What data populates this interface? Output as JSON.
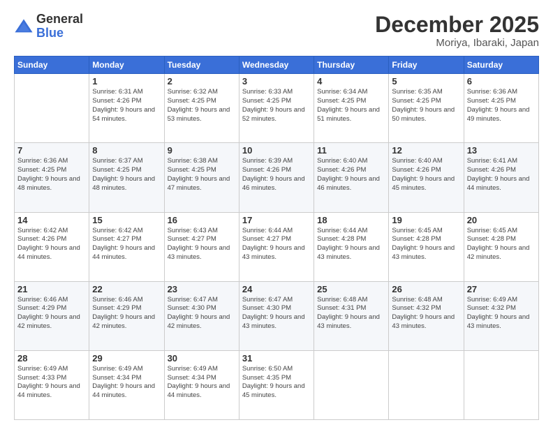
{
  "header": {
    "logo": {
      "line1": "General",
      "line2": "Blue"
    },
    "title": "December 2025",
    "subtitle": "Moriya, Ibaraki, Japan"
  },
  "weekdays": [
    "Sunday",
    "Monday",
    "Tuesday",
    "Wednesday",
    "Thursday",
    "Friday",
    "Saturday"
  ],
  "weeks": [
    [
      {
        "day": "",
        "sunrise": "",
        "sunset": "",
        "daylight": "",
        "empty": true
      },
      {
        "day": "1",
        "sunrise": "Sunrise: 6:31 AM",
        "sunset": "Sunset: 4:26 PM",
        "daylight": "Daylight: 9 hours and 54 minutes."
      },
      {
        "day": "2",
        "sunrise": "Sunrise: 6:32 AM",
        "sunset": "Sunset: 4:25 PM",
        "daylight": "Daylight: 9 hours and 53 minutes."
      },
      {
        "day": "3",
        "sunrise": "Sunrise: 6:33 AM",
        "sunset": "Sunset: 4:25 PM",
        "daylight": "Daylight: 9 hours and 52 minutes."
      },
      {
        "day": "4",
        "sunrise": "Sunrise: 6:34 AM",
        "sunset": "Sunset: 4:25 PM",
        "daylight": "Daylight: 9 hours and 51 minutes."
      },
      {
        "day": "5",
        "sunrise": "Sunrise: 6:35 AM",
        "sunset": "Sunset: 4:25 PM",
        "daylight": "Daylight: 9 hours and 50 minutes."
      },
      {
        "day": "6",
        "sunrise": "Sunrise: 6:36 AM",
        "sunset": "Sunset: 4:25 PM",
        "daylight": "Daylight: 9 hours and 49 minutes."
      }
    ],
    [
      {
        "day": "7",
        "sunrise": "Sunrise: 6:36 AM",
        "sunset": "Sunset: 4:25 PM",
        "daylight": "Daylight: 9 hours and 48 minutes."
      },
      {
        "day": "8",
        "sunrise": "Sunrise: 6:37 AM",
        "sunset": "Sunset: 4:25 PM",
        "daylight": "Daylight: 9 hours and 48 minutes."
      },
      {
        "day": "9",
        "sunrise": "Sunrise: 6:38 AM",
        "sunset": "Sunset: 4:25 PM",
        "daylight": "Daylight: 9 hours and 47 minutes."
      },
      {
        "day": "10",
        "sunrise": "Sunrise: 6:39 AM",
        "sunset": "Sunset: 4:26 PM",
        "daylight": "Daylight: 9 hours and 46 minutes."
      },
      {
        "day": "11",
        "sunrise": "Sunrise: 6:40 AM",
        "sunset": "Sunset: 4:26 PM",
        "daylight": "Daylight: 9 hours and 46 minutes."
      },
      {
        "day": "12",
        "sunrise": "Sunrise: 6:40 AM",
        "sunset": "Sunset: 4:26 PM",
        "daylight": "Daylight: 9 hours and 45 minutes."
      },
      {
        "day": "13",
        "sunrise": "Sunrise: 6:41 AM",
        "sunset": "Sunset: 4:26 PM",
        "daylight": "Daylight: 9 hours and 44 minutes."
      }
    ],
    [
      {
        "day": "14",
        "sunrise": "Sunrise: 6:42 AM",
        "sunset": "Sunset: 4:26 PM",
        "daylight": "Daylight: 9 hours and 44 minutes."
      },
      {
        "day": "15",
        "sunrise": "Sunrise: 6:42 AM",
        "sunset": "Sunset: 4:27 PM",
        "daylight": "Daylight: 9 hours and 44 minutes."
      },
      {
        "day": "16",
        "sunrise": "Sunrise: 6:43 AM",
        "sunset": "Sunset: 4:27 PM",
        "daylight": "Daylight: 9 hours and 43 minutes."
      },
      {
        "day": "17",
        "sunrise": "Sunrise: 6:44 AM",
        "sunset": "Sunset: 4:27 PM",
        "daylight": "Daylight: 9 hours and 43 minutes."
      },
      {
        "day": "18",
        "sunrise": "Sunrise: 6:44 AM",
        "sunset": "Sunset: 4:28 PM",
        "daylight": "Daylight: 9 hours and 43 minutes."
      },
      {
        "day": "19",
        "sunrise": "Sunrise: 6:45 AM",
        "sunset": "Sunset: 4:28 PM",
        "daylight": "Daylight: 9 hours and 43 minutes."
      },
      {
        "day": "20",
        "sunrise": "Sunrise: 6:45 AM",
        "sunset": "Sunset: 4:28 PM",
        "daylight": "Daylight: 9 hours and 42 minutes."
      }
    ],
    [
      {
        "day": "21",
        "sunrise": "Sunrise: 6:46 AM",
        "sunset": "Sunset: 4:29 PM",
        "daylight": "Daylight: 9 hours and 42 minutes."
      },
      {
        "day": "22",
        "sunrise": "Sunrise: 6:46 AM",
        "sunset": "Sunset: 4:29 PM",
        "daylight": "Daylight: 9 hours and 42 minutes."
      },
      {
        "day": "23",
        "sunrise": "Sunrise: 6:47 AM",
        "sunset": "Sunset: 4:30 PM",
        "daylight": "Daylight: 9 hours and 42 minutes."
      },
      {
        "day": "24",
        "sunrise": "Sunrise: 6:47 AM",
        "sunset": "Sunset: 4:30 PM",
        "daylight": "Daylight: 9 hours and 43 minutes."
      },
      {
        "day": "25",
        "sunrise": "Sunrise: 6:48 AM",
        "sunset": "Sunset: 4:31 PM",
        "daylight": "Daylight: 9 hours and 43 minutes."
      },
      {
        "day": "26",
        "sunrise": "Sunrise: 6:48 AM",
        "sunset": "Sunset: 4:32 PM",
        "daylight": "Daylight: 9 hours and 43 minutes."
      },
      {
        "day": "27",
        "sunrise": "Sunrise: 6:49 AM",
        "sunset": "Sunset: 4:32 PM",
        "daylight": "Daylight: 9 hours and 43 minutes."
      }
    ],
    [
      {
        "day": "28",
        "sunrise": "Sunrise: 6:49 AM",
        "sunset": "Sunset: 4:33 PM",
        "daylight": "Daylight: 9 hours and 44 minutes."
      },
      {
        "day": "29",
        "sunrise": "Sunrise: 6:49 AM",
        "sunset": "Sunset: 4:34 PM",
        "daylight": "Daylight: 9 hours and 44 minutes."
      },
      {
        "day": "30",
        "sunrise": "Sunrise: 6:49 AM",
        "sunset": "Sunset: 4:34 PM",
        "daylight": "Daylight: 9 hours and 44 minutes."
      },
      {
        "day": "31",
        "sunrise": "Sunrise: 6:50 AM",
        "sunset": "Sunset: 4:35 PM",
        "daylight": "Daylight: 9 hours and 45 minutes."
      },
      {
        "day": "",
        "sunrise": "",
        "sunset": "",
        "daylight": "",
        "empty": true
      },
      {
        "day": "",
        "sunrise": "",
        "sunset": "",
        "daylight": "",
        "empty": true
      },
      {
        "day": "",
        "sunrise": "",
        "sunset": "",
        "daylight": "",
        "empty": true
      }
    ]
  ]
}
